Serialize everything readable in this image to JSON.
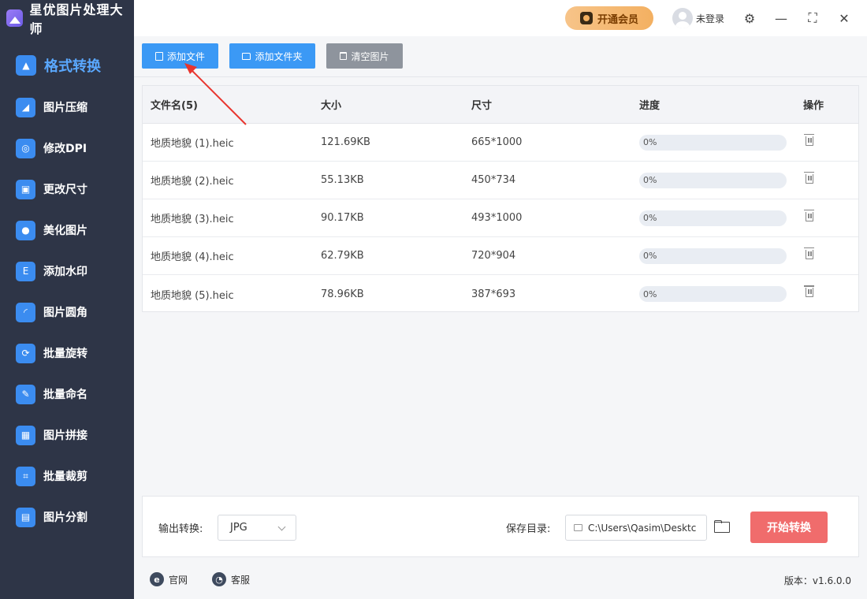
{
  "app": {
    "title": "星优图片处理大师"
  },
  "sidebar": {
    "items": [
      {
        "label": "格式转换",
        "glyph": "▲"
      },
      {
        "label": "图片压缩",
        "glyph": "◢"
      },
      {
        "label": "修改DPI",
        "glyph": "◎"
      },
      {
        "label": "更改尺寸",
        "glyph": "▣"
      },
      {
        "label": "美化图片",
        "glyph": "●"
      },
      {
        "label": "添加水印",
        "glyph": "E"
      },
      {
        "label": "图片圆角",
        "glyph": "◜"
      },
      {
        "label": "批量旋转",
        "glyph": "⟳"
      },
      {
        "label": "批量命名",
        "glyph": "✎"
      },
      {
        "label": "图片拼接",
        "glyph": "▦"
      },
      {
        "label": "批量裁剪",
        "glyph": "⌗"
      },
      {
        "label": "图片分割",
        "glyph": "▤"
      }
    ]
  },
  "topbar": {
    "vip_label": "开通会员",
    "user_label": "未登录",
    "settings_glyph": "⚙",
    "minimize_glyph": "—",
    "maximize_glyph": "⛶",
    "close_glyph": "✕"
  },
  "toolbar": {
    "add_file": "添加文件",
    "add_folder": "添加文件夹",
    "clear": "清空图片"
  },
  "table": {
    "headers": [
      "文件名(5)",
      "大小",
      "尺寸",
      "进度",
      "操作"
    ],
    "rows": [
      {
        "name": "地质地貌 (1).heic",
        "size": "121.69KB",
        "dims": "665*1000",
        "progress": "0%",
        "progress_value": 0
      },
      {
        "name": "地质地貌 (2).heic",
        "size": "55.13KB",
        "dims": "450*734",
        "progress": "0%",
        "progress_value": 0
      },
      {
        "name": "地质地貌 (3).heic",
        "size": "90.17KB",
        "dims": "493*1000",
        "progress": "0%",
        "progress_value": 0
      },
      {
        "name": "地质地貌 (4).heic",
        "size": "62.79KB",
        "dims": "720*904",
        "progress": "0%",
        "progress_value": 0
      },
      {
        "name": "地质地貌 (5).heic",
        "size": "78.96KB",
        "dims": "387*693",
        "progress": "0%",
        "progress_value": 0
      }
    ]
  },
  "bottom": {
    "output_label": "输出转换:",
    "format_value": "JPG",
    "save_label": "保存目录:",
    "save_path": "C:\\Users\\Qasim\\Desktc",
    "start_label": "开始转换"
  },
  "footer": {
    "website": "官网",
    "support": "客服",
    "version": "版本：v1.6.0.0"
  },
  "colors": {
    "accent": "#3b99f5",
    "sidebar_bg": "#2e3547",
    "start_button": "#f06c6c",
    "annotation_arrow": "#e8352e"
  }
}
